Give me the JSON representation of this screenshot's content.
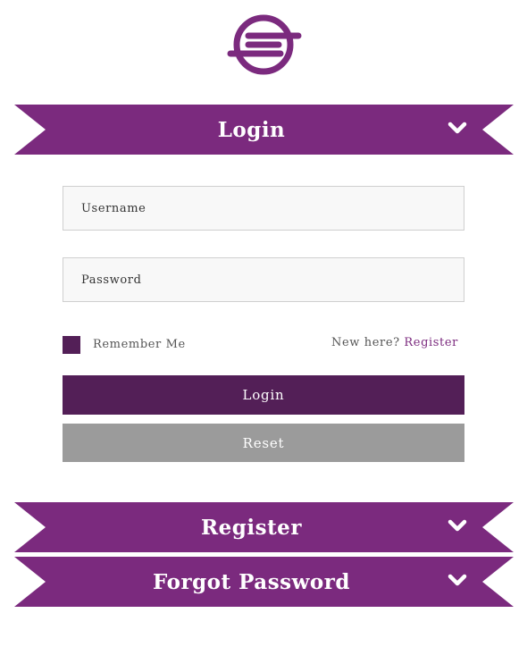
{
  "logo": {
    "icon": "brand-logo-icon",
    "color": "#7b2a7e"
  },
  "sections": {
    "login": {
      "title": "Login",
      "icon": "chevron-down-icon"
    },
    "register": {
      "title": "Register",
      "icon": "chevron-down-icon"
    },
    "forgot": {
      "title": "Forgot Password",
      "icon": "chevron-down-icon"
    }
  },
  "form": {
    "username_placeholder": "Username",
    "username_value": "",
    "password_placeholder": "Password",
    "password_value": "",
    "remember_label": "Remember Me",
    "new_here_text": "New here?",
    "register_link": "Register",
    "login_button": "Login",
    "reset_button": "Reset"
  },
  "colors": {
    "ribbon": "#7b2a7e",
    "primary_button": "#531f57",
    "reset_button": "#9b9b9b",
    "checkbox": "#531f57"
  }
}
